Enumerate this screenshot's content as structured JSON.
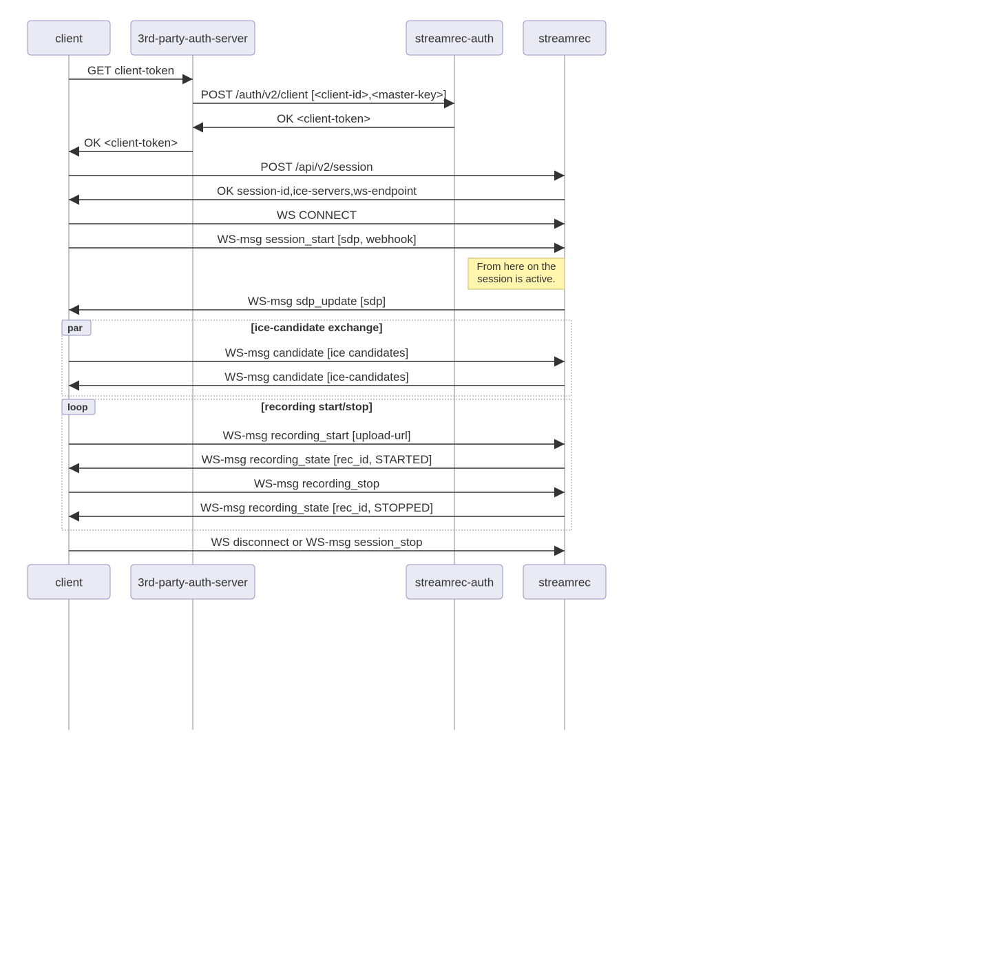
{
  "actors": [
    "client",
    "3rd-party-auth-server",
    "streamrec-auth",
    "streamrec"
  ],
  "messages": [
    {
      "text": "GET client-token",
      "from": 0,
      "to": 1
    },
    {
      "text": "POST /auth/v2/client [<client-id>,<master-key>]",
      "from": 1,
      "to": 2
    },
    {
      "text": "OK <client-token>",
      "from": 2,
      "to": 1
    },
    {
      "text": "OK <client-token>",
      "from": 1,
      "to": 0
    },
    {
      "text": "POST /api/v2/session",
      "from": 0,
      "to": 3
    },
    {
      "text": "OK session-id,ice-servers,ws-endpoint",
      "from": 3,
      "to": 0
    },
    {
      "text": "WS CONNECT",
      "from": 0,
      "to": 3
    },
    {
      "text": "WS-msg session_start [sdp, webhook]",
      "from": 0,
      "to": 3
    },
    {
      "text": "WS-msg sdp_update [sdp]",
      "from": 3,
      "to": 0
    },
    {
      "text": "WS-msg candidate [ice candidates]",
      "from": 0,
      "to": 3
    },
    {
      "text": "WS-msg candidate [ice-candidates]",
      "from": 3,
      "to": 0
    },
    {
      "text": "WS-msg recording_start [upload-url]",
      "from": 0,
      "to": 3
    },
    {
      "text": "WS-msg recording_state [rec_id, STARTED]",
      "from": 3,
      "to": 0
    },
    {
      "text": "WS-msg recording_stop",
      "from": 0,
      "to": 3
    },
    {
      "text": "WS-msg recording_state [rec_id, STOPPED]",
      "from": 3,
      "to": 0
    },
    {
      "text": "WS disconnect or WS-msg session_stop",
      "from": 0,
      "to": 3
    }
  ],
  "note": {
    "lines": [
      "From here on the",
      "session is active."
    ]
  },
  "fragments": [
    {
      "label": "par",
      "title": "[ice-candidate exchange]"
    },
    {
      "label": "loop",
      "title": "[recording start/stop]"
    }
  ]
}
